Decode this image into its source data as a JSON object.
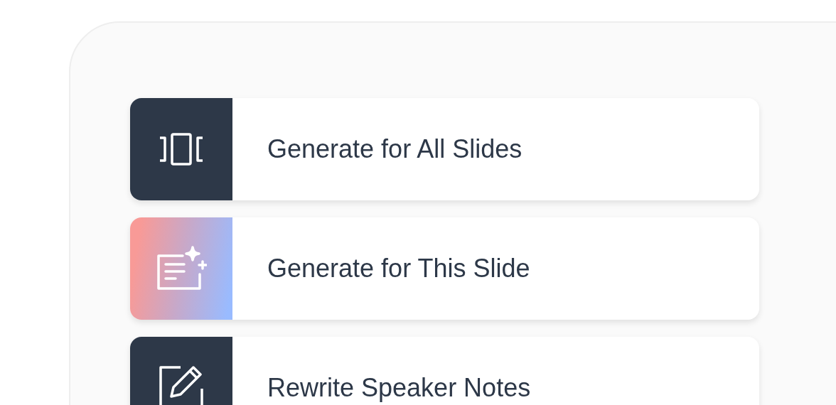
{
  "actions": [
    {
      "label": "Generate for All Slides",
      "kind": "slides",
      "highlighted": false
    },
    {
      "label": "Generate for This Slide",
      "kind": "sparkle-note",
      "highlighted": true
    },
    {
      "label": "Rewrite Speaker Notes",
      "kind": "edit",
      "highlighted": false
    }
  ]
}
